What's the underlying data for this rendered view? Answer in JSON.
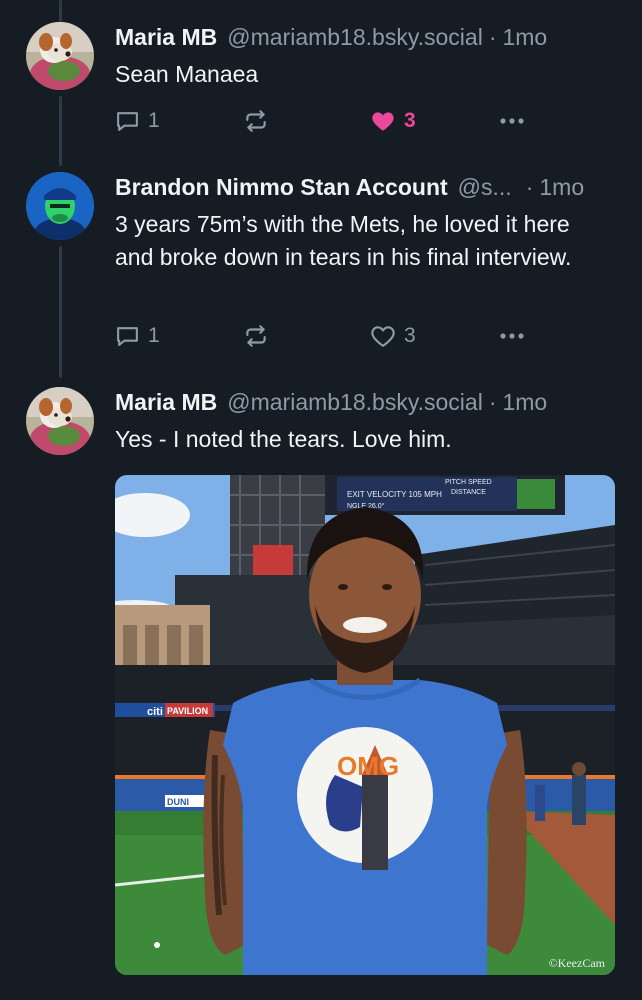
{
  "posts": [
    {
      "name": "Maria MB",
      "handle": "@mariamb18.bsky.social",
      "separator": "·",
      "time": "1mo",
      "text": "Sean Manaea",
      "replies": "1",
      "likes": "3",
      "liked": true,
      "avatar_icon": "dog-avatar"
    },
    {
      "name": "Brandon Nimmo Stan Account",
      "handle": "@s...",
      "separator": "·",
      "time": "1mo",
      "text": "3 years 75m’s with the Mets, he loved it here and broke down in tears in his final interview.",
      "replies": "1",
      "likes": "3",
      "liked": false,
      "avatar_icon": "player-avatar"
    },
    {
      "name": "Maria MB",
      "handle": "@mariamb18.bsky.social",
      "separator": "·",
      "time": "1mo",
      "text": "Yes - I noted the tears. Love him.",
      "avatar_icon": "dog-avatar"
    }
  ],
  "image": {
    "scoreboard_line1": "EXIT VELOCITY  105 MPH",
    "scoreboard_line2": "PITCH SPEED",
    "scoreboard_line3": "DISTANCE",
    "scoreboard_line4": "NGLE  26.0°",
    "sign_citi": "citi",
    "sign_pavilion": "PAVILION",
    "shirt_text": "OMG",
    "banner_text": "DUNI",
    "watermark": "©KeezCam"
  },
  "colors": {
    "background": "#151c24",
    "like_pink": "#ec4899",
    "muted": "#8d9aa8"
  }
}
